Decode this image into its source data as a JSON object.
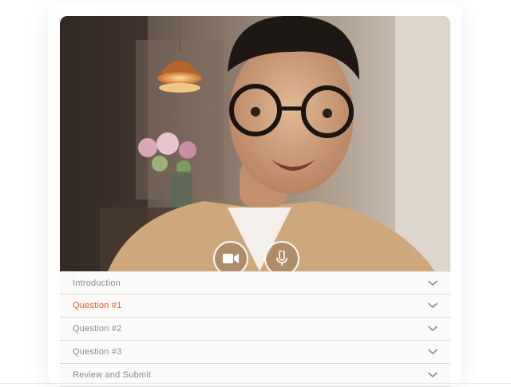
{
  "accordion": {
    "items": [
      {
        "label": "Introduction",
        "active": false
      },
      {
        "label": "Question #1",
        "active": true
      },
      {
        "label": "Question #2",
        "active": false
      },
      {
        "label": "Question #3",
        "active": false
      },
      {
        "label": "Review and Submit",
        "active": false
      }
    ]
  },
  "controls": {
    "camera_icon": "video-camera-icon",
    "mic_icon": "microphone-icon"
  },
  "colors": {
    "active": "#e8552b",
    "label": "#8a8a8a",
    "divider": "#d9d9d9"
  }
}
